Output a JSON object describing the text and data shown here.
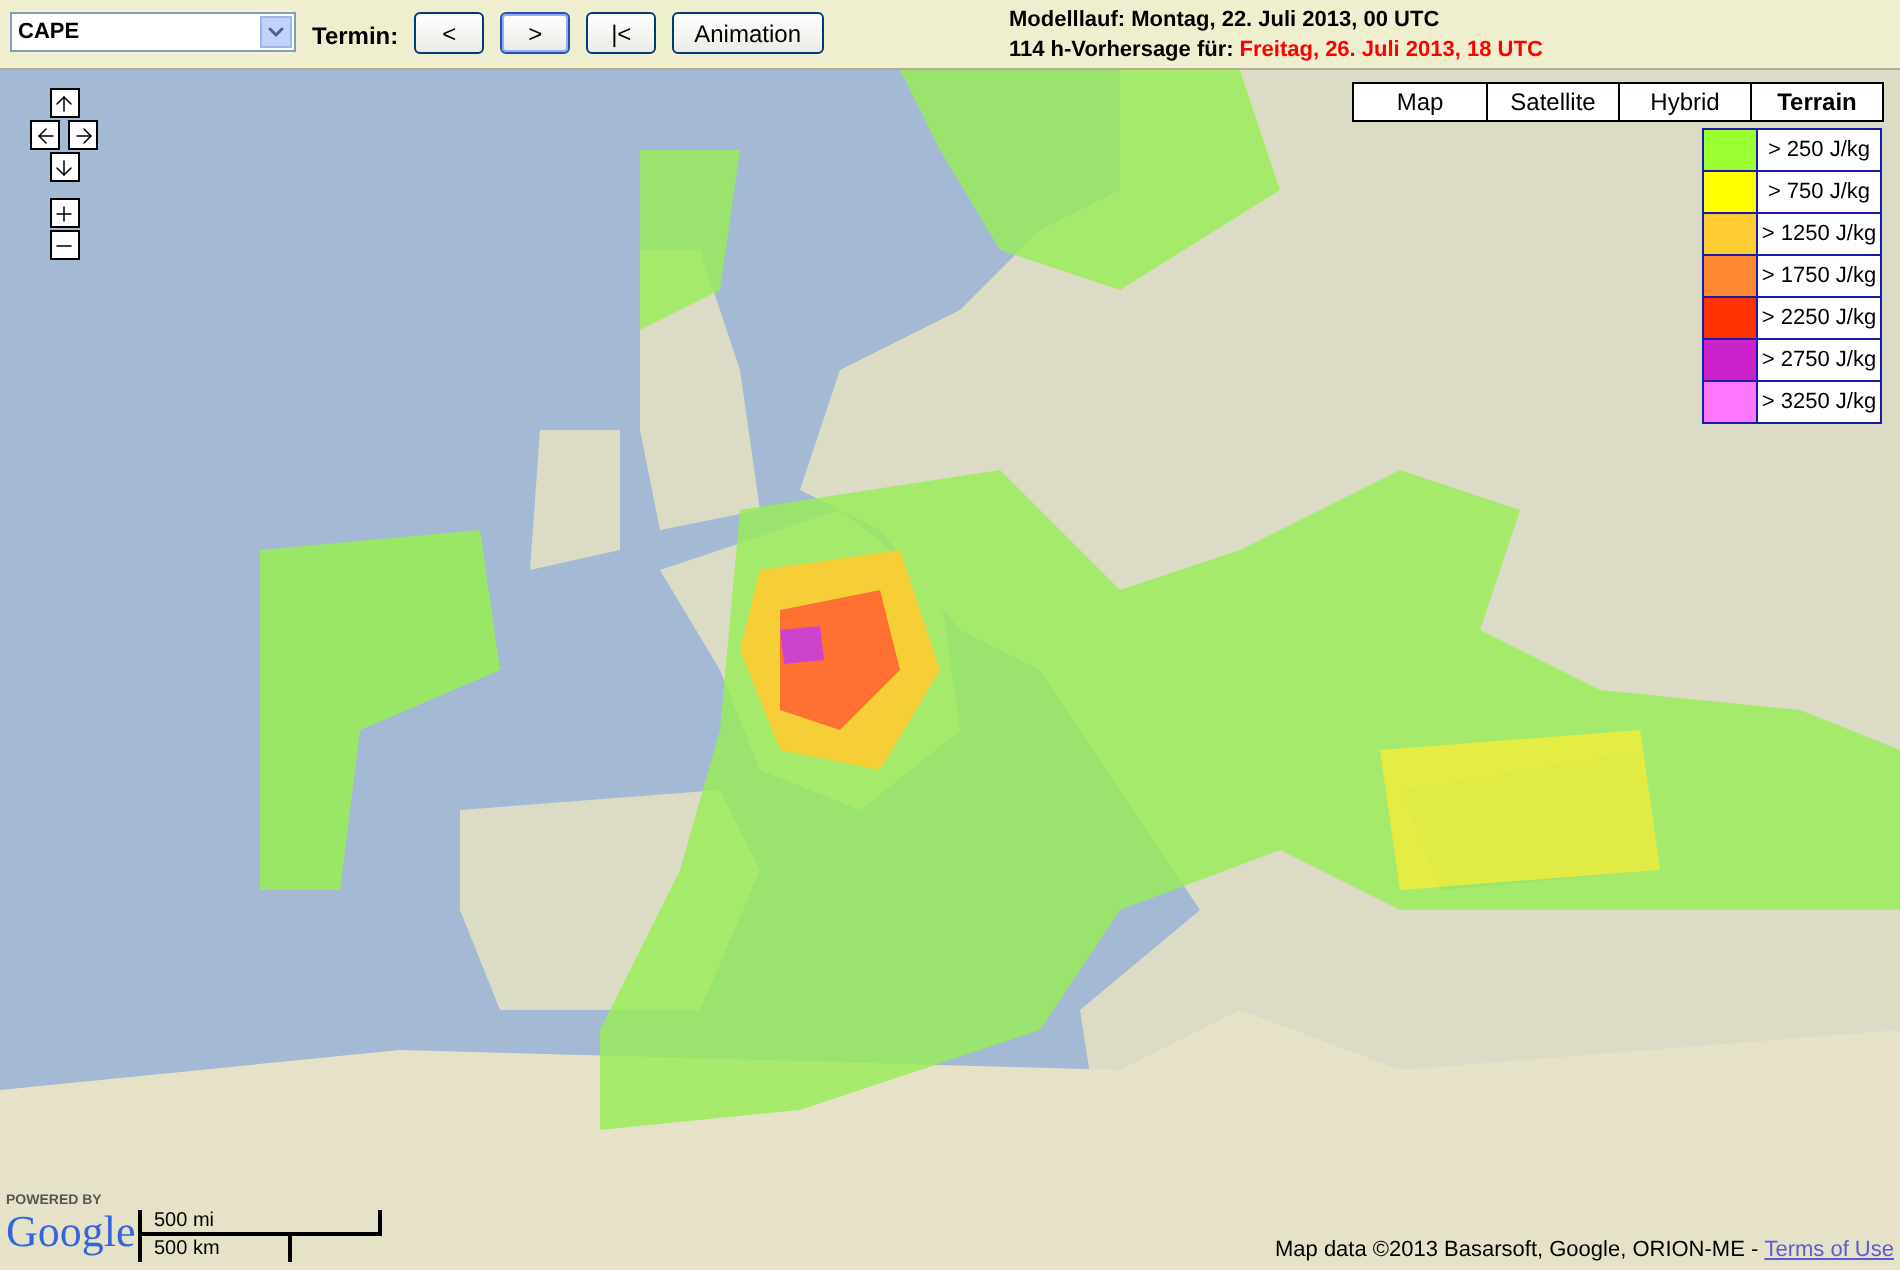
{
  "toolbar": {
    "variable": "CAPE",
    "termin_label": "Termin:",
    "buttons": [
      {
        "label": "<",
        "focused": false
      },
      {
        "label": ">",
        "focused": true
      },
      {
        "label": "|<",
        "focused": false
      },
      {
        "label": "Animation",
        "focused": false
      }
    ]
  },
  "run_info": {
    "model_run": "Modelllauf: Montag, 22. Juli 2013, 00 UTC",
    "forecast_label": "114 h-Vorhersage für:",
    "forecast_time": "Freitag, 26. Juli 2013, 18 UTC"
  },
  "map": {
    "map_types": [
      {
        "label": "Map",
        "selected": false
      },
      {
        "label": "Satellite",
        "selected": false
      },
      {
        "label": "Hybrid",
        "selected": false
      },
      {
        "label": "Terrain",
        "selected": true
      }
    ],
    "legend": [
      {
        "color": "#99ff33",
        "label": "> 250 J/kg"
      },
      {
        "color": "#ffff00",
        "label": "> 750 J/kg"
      },
      {
        "color": "#ffcc33",
        "label": "> 1250 J/kg"
      },
      {
        "color": "#ff8833",
        "label": "> 1750 J/kg"
      },
      {
        "color": "#ff3300",
        "label": "> 2250 J/kg"
      },
      {
        "color": "#cc22cc",
        "label": "> 2750 J/kg"
      },
      {
        "color": "#ff77ff",
        "label": "> 3250 J/kg"
      }
    ],
    "scale": {
      "miles": "500 mi",
      "km": "500 km"
    },
    "logo": {
      "powered_by": "POWERED BY",
      "name": "Google"
    },
    "attribution": "Map data ©2013 Basarsoft, Google, ORION-ME - ",
    "terms_link": "Terms of Use"
  }
}
